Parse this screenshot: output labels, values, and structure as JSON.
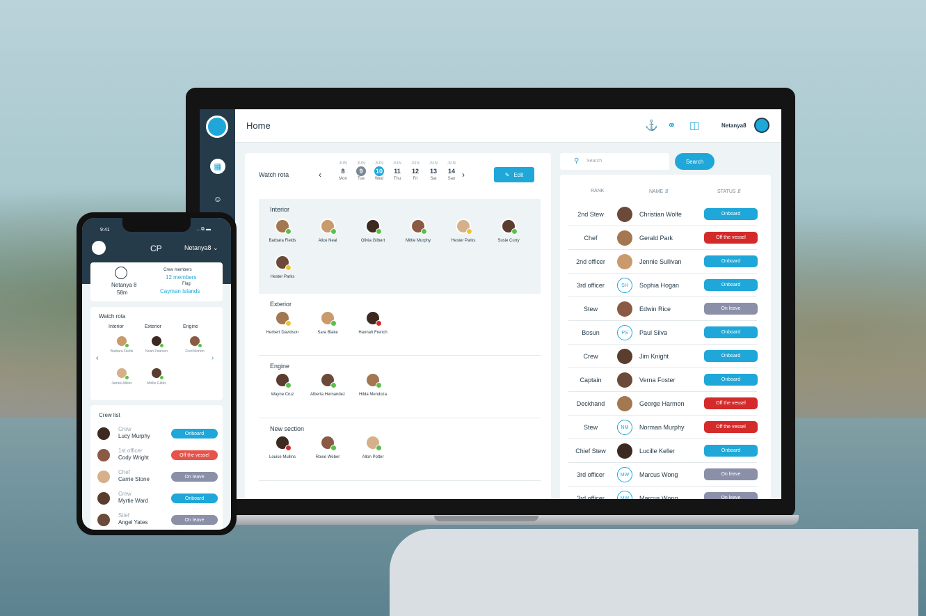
{
  "colors": {
    "accent": "#1ea7d8",
    "dark": "#263b4a",
    "onboard": "#1ea7d8",
    "off": "#d42a2a",
    "leave": "#8b8fa8",
    "online": "#5bbf4a",
    "away": "#f2c230",
    "busy": "#d42a2a"
  },
  "header": {
    "title": "Home",
    "user": "Netanya8"
  },
  "watch": {
    "label": "Watch rota",
    "edit": "Edit",
    "days": [
      {
        "m": "JUN",
        "d": "8",
        "w": "Mon"
      },
      {
        "m": "JUN",
        "d": "9",
        "w": "Tue"
      },
      {
        "m": "JUN",
        "d": "10",
        "w": "Wed"
      },
      {
        "m": "JUN",
        "d": "11",
        "w": "Thu"
      },
      {
        "m": "JUN",
        "d": "12",
        "w": "Fri"
      },
      {
        "m": "JUN",
        "d": "13",
        "w": "Sat"
      },
      {
        "m": "JUN",
        "d": "14",
        "w": "San"
      }
    ]
  },
  "sections": {
    "interior": {
      "title": "Interior",
      "members": [
        "Barbara Fields",
        "Alice Neal",
        "Olivia Gilbert",
        "Mittie Murphy",
        "Hester Parks",
        "Susie Curry",
        "Hester Parks"
      ]
    },
    "exterior": {
      "title": "Exterior",
      "members": [
        "Herbert Davidson",
        "Sara Blake",
        "Hannah French"
      ]
    },
    "engine": {
      "title": "Engine",
      "members": [
        "Wayne Cruz",
        "Alberta Hernandez",
        "Hilda Mendoza"
      ]
    },
    "newsection": {
      "title": "New section",
      "members": [
        "Louise Mullins",
        "Roxie Weber",
        "Allon Potter"
      ]
    }
  },
  "search": {
    "placeholder": "Search",
    "button": "Search"
  },
  "table": {
    "headers": {
      "rank": "RANK",
      "name": "NAME",
      "status": "STATUS"
    },
    "rows": [
      {
        "rank": "2nd Stew",
        "name": "Christian Wolfe",
        "status": "Onboard",
        "initials": ""
      },
      {
        "rank": "Chef",
        "name": "Gerald Park",
        "status": "Off the vessel",
        "initials": ""
      },
      {
        "rank": "2nd officer",
        "name": "Jennie Sullivan",
        "status": "Onboard",
        "initials": ""
      },
      {
        "rank": "3rd officer",
        "name": "Sophia Hogan",
        "status": "Onboard",
        "initials": "SH"
      },
      {
        "rank": "Stew",
        "name": "Edwin Rice",
        "status": "On leave",
        "initials": ""
      },
      {
        "rank": "Bosun",
        "name": "Paul Silva",
        "status": "Onboard",
        "initials": "PS"
      },
      {
        "rank": "Crew",
        "name": "Jim Knight",
        "status": "Onboard",
        "initials": ""
      },
      {
        "rank": "Captain",
        "name": "Verna Foster",
        "status": "Onboard",
        "initials": ""
      },
      {
        "rank": "Deckhand",
        "name": "George Harmon",
        "status": "Off the vessel",
        "initials": ""
      },
      {
        "rank": "Stew",
        "name": "Norman Murphy",
        "status": "Off the vessel",
        "initials": "NM"
      },
      {
        "rank": "Chief Stew",
        "name": "Lucille Keller",
        "status": "Onboard",
        "initials": ""
      },
      {
        "rank": "3rd officer",
        "name": "Marcus Wong",
        "status": "On leave",
        "initials": "MW"
      },
      {
        "rank": "3rd officer",
        "name": "Marcus Wong",
        "status": "On leave",
        "initials": "MW"
      }
    ]
  },
  "phone": {
    "time": "9:41",
    "status_icons": "…⧉ ▬",
    "title": "CP",
    "user": "Netanya8 ⌄",
    "vessel": {
      "name": "Netanya 8",
      "length": "58m",
      "crew_label": "Crew members",
      "crew_value": "12 members",
      "flag_label": "Flag",
      "flag_value": "Cayman Islands"
    },
    "rota": {
      "title": "Watch rota",
      "cols": [
        "Interior",
        "Exterior",
        "Engine"
      ],
      "members": [
        "Barbara Fields",
        "Noah Pearson",
        "Fred Morton",
        "James Atkins",
        "Mollie Gibbs"
      ]
    },
    "crew": {
      "title": "Crew list",
      "rows": [
        {
          "rank": "Crew",
          "name": "Lucy Murphy",
          "status": "Onboard"
        },
        {
          "rank": "1st officer",
          "name": "Cody Wright",
          "status": "Off the vessel"
        },
        {
          "rank": "Chef",
          "name": "Carrie Stone",
          "status": "On leave"
        },
        {
          "rank": "Crew",
          "name": "Myrtie Ward",
          "status": "Onboard"
        },
        {
          "rank": "Stief",
          "name": "Angel Yates",
          "status": "On leave"
        }
      ]
    }
  }
}
